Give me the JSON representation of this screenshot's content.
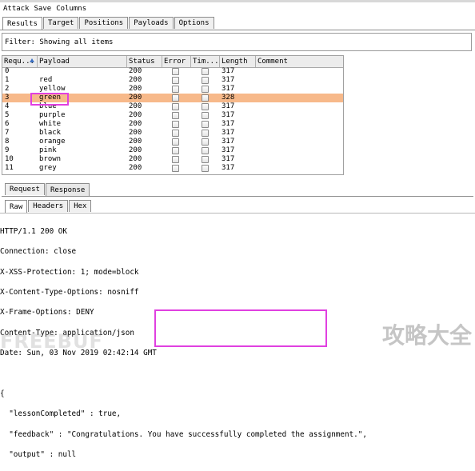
{
  "menubar": {
    "items": [
      "Attack",
      "Save",
      "Columns"
    ]
  },
  "result_tabs": [
    "Results",
    "Target",
    "Positions",
    "Payloads",
    "Options"
  ],
  "filter": {
    "text": "Filter: Showing all items"
  },
  "table": {
    "columns": [
      "Requ...",
      "Payload",
      "Status",
      "Error",
      "Tim...",
      "Length",
      "Comment"
    ],
    "rows": [
      {
        "request": "0",
        "payload": "",
        "status": "200",
        "length": "317"
      },
      {
        "request": "1",
        "payload": "red",
        "status": "200",
        "length": "317"
      },
      {
        "request": "2",
        "payload": "yellow",
        "status": "200",
        "length": "317"
      },
      {
        "request": "3",
        "payload": "green",
        "status": "200",
        "length": "328",
        "highlighted": true
      },
      {
        "request": "4",
        "payload": "blue",
        "status": "200",
        "length": "317"
      },
      {
        "request": "5",
        "payload": "purple",
        "status": "200",
        "length": "317"
      },
      {
        "request": "6",
        "payload": "white",
        "status": "200",
        "length": "317"
      },
      {
        "request": "7",
        "payload": "black",
        "status": "200",
        "length": "317"
      },
      {
        "request": "8",
        "payload": "orange",
        "status": "200",
        "length": "317"
      },
      {
        "request": "9",
        "payload": "pink",
        "status": "200",
        "length": "317"
      },
      {
        "request": "10",
        "payload": "brown",
        "status": "200",
        "length": "317"
      },
      {
        "request": "11",
        "payload": "grey",
        "status": "200",
        "length": "317"
      }
    ]
  },
  "reqresp_tabs": [
    "Request",
    "Response"
  ],
  "view_tabs": [
    "Raw",
    "Headers",
    "Hex"
  ],
  "response": {
    "lines": [
      "HTTP/1.1 200 OK",
      "Connection: close",
      "X-XSS-Protection: 1; mode=block",
      "X-Content-Type-Options: nosniff",
      "X-Frame-Options: DENY",
      "Content-Type: application/json",
      "Date: Sun, 03 Nov 2019 02:42:14 GMT",
      "",
      "{",
      "  \"lessonCompleted\" : true,",
      "  \"feedback\" : \"Congratulations. You have successfully completed the assignment.\",",
      "  \"output\" : null"
    ]
  },
  "watermarks": {
    "left": "FREEBUF",
    "right": "攻略大全"
  },
  "colors": {
    "highlight_row": "#f7b98a",
    "annotation_box": "#e040e0"
  }
}
